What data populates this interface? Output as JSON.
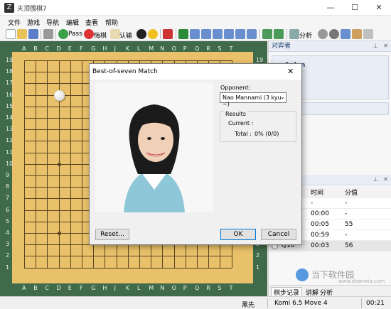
{
  "app": {
    "title": "天顶围棋7",
    "icon_glyph": "Z",
    "win_min": "—",
    "win_max": "☐",
    "win_close": "✕"
  },
  "menu": [
    "文件",
    "游戏",
    "导航",
    "编辑",
    "查看",
    "帮助"
  ],
  "toolbar": {
    "pass": "Pass",
    "undo": "悔棋",
    "resign": "认输",
    "analyze": "分析"
  },
  "board": {
    "cols": [
      "A",
      "B",
      "C",
      "D",
      "E",
      "F",
      "G",
      "H",
      "J",
      "K",
      "L",
      "M",
      "N",
      "O",
      "P",
      "Q",
      "R",
      "S",
      "T"
    ],
    "rows": [
      "19",
      "18",
      "17",
      "16",
      "15",
      "14",
      "13",
      "12",
      "11",
      "10",
      "9",
      "8",
      "7",
      "6",
      "5",
      "4",
      "3",
      "2",
      "1"
    ],
    "stones": [
      {
        "point": "D16",
        "color": "white"
      }
    ]
  },
  "panel": {
    "players_title": "对弈者",
    "pin": "⊥",
    "close": "✕",
    "player_rank": "1 dan",
    "moves_headers": [
      "时间",
      "分值"
    ],
    "moves": [
      {
        "move": "",
        "time": "-",
        "score": "-"
      },
      {
        "move": "",
        "time": "00:00",
        "score": "-"
      },
      {
        "move": "",
        "time": "00:05",
        "score": "55"
      },
      {
        "move": "",
        "time": "00:59",
        "score": "-"
      },
      {
        "move": "Q16",
        "time": "00:03",
        "score": "56"
      }
    ],
    "tabs": [
      "棋步记录",
      "讲解",
      "分析"
    ],
    "watermark_main": "当下软件园",
    "watermark_url": "www.downxia.com"
  },
  "status": {
    "to_move": "黑先",
    "komi": "Komi 6.5",
    "move": "Move 4",
    "clock": "00:21"
  },
  "dialog": {
    "title": "Best-of-seven Match",
    "close": "✕",
    "opponent_label": "Opponent:",
    "opponent_value": "Nao Mannami (3 kyu ~)",
    "results_label": "Results",
    "current_label": "Current :",
    "total_label": "Total :",
    "total_value": "0% (0/0)",
    "reset": "Reset...",
    "ok": "OK",
    "cancel": "Cancel"
  },
  "colors": {
    "accent": "#0078d7",
    "board": "#e9c16a",
    "board_frame": "#3f6b4a"
  }
}
